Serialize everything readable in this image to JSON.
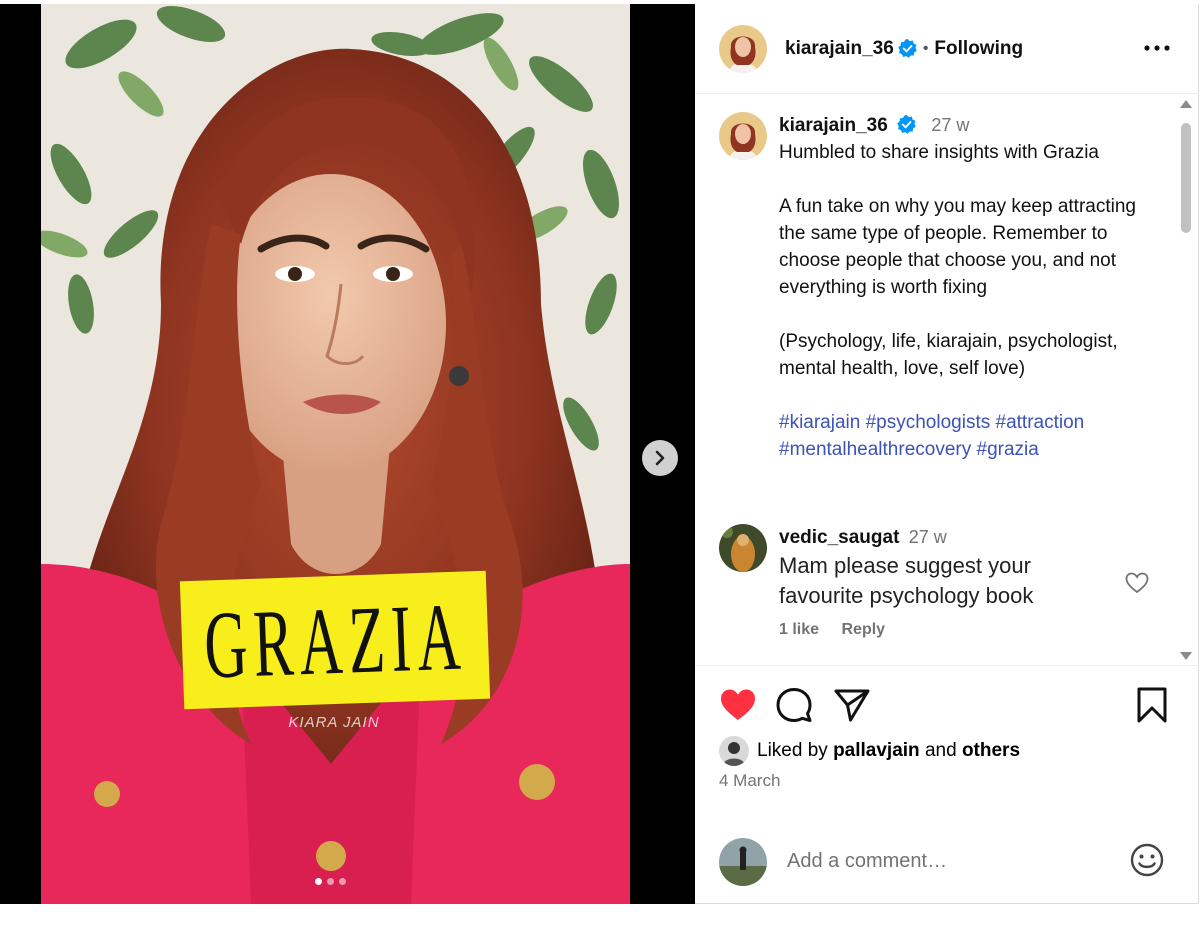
{
  "post": {
    "username": "kiarajain_36",
    "follow_status": "Following",
    "separator": "•",
    "magazine_logo": "GRAZIA",
    "photo_author": "KIARA JAIN",
    "carousel": {
      "count": 3,
      "active_index": 0
    }
  },
  "caption": {
    "username": "kiarajain_36",
    "time": "27 w",
    "text": "Humbled to share insights with Grazia\n\nA fun take on why you may keep attracting the same type of people. Remember to choose people that choose you, and not everything is worth fixing\n\n(Psychology, life, kiarajain, psychologist, mental health, love, self love)",
    "hashtags": [
      "#kiarajain",
      "#psychologists",
      "#attraction",
      "#mentalhealthrecovery",
      "#grazia"
    ]
  },
  "comment": {
    "username": "vedic_saugat",
    "time": "27 w",
    "text": "Mam please suggest your favourite psychology book",
    "likes": "1 like",
    "reply_label": "Reply"
  },
  "engagement": {
    "liked_by_prefix": "Liked by",
    "liked_by_user": "pallavjain",
    "liked_by_joiner": "and",
    "liked_by_others": "others",
    "date": "4 March"
  },
  "add_comment": {
    "placeholder": "Add a comment…"
  },
  "icons": {
    "like": "heart-filled-icon",
    "comment": "comment-bubble-icon",
    "share": "paper-plane-icon",
    "save": "bookmark-icon",
    "more": "more-options-icon",
    "verified": "verified-badge-icon",
    "emoji": "emoji-icon",
    "next": "chevron-right-icon"
  },
  "colors": {
    "like_red": "#ff3040",
    "verified_blue": "#0095f6",
    "hashtag_blue": "#3b52b8",
    "grazia_yellow": "#f7ee1c",
    "cardigan_pink": "#e8275a",
    "hair_auburn": "#8e3420"
  }
}
